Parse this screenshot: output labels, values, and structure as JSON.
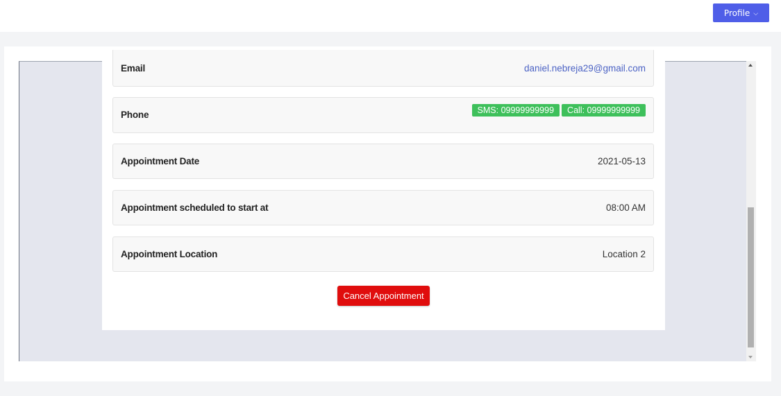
{
  "header": {
    "profile_label": "Profile",
    "profile_chevron": "⌵"
  },
  "details": {
    "email": {
      "label": "Email",
      "value": "daniel.nebreja29@gmail.com"
    },
    "phone": {
      "label": "Phone",
      "sms": "SMS: 09999999999",
      "call": "Call: 09999999999"
    },
    "date": {
      "label": "Appointment Date",
      "value": "2021-05-13"
    },
    "time": {
      "label": "Appointment scheduled to start at",
      "value": "08:00 AM"
    },
    "location": {
      "label": "Appointment Location",
      "value": "Location 2"
    }
  },
  "actions": {
    "cancel_label": "Cancel Appointment"
  },
  "colors": {
    "accent": "#4f5ee8",
    "danger": "#e00d0d",
    "success": "#3ec05b",
    "link": "#4b62c4"
  }
}
